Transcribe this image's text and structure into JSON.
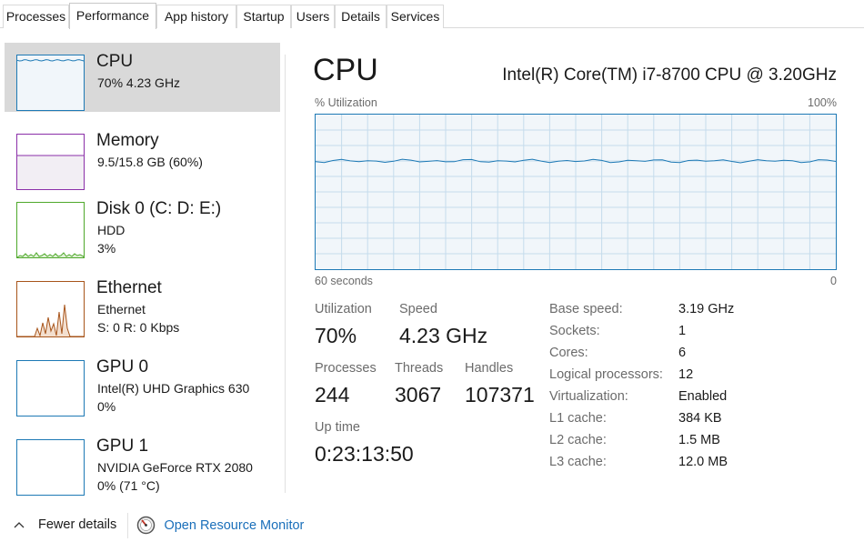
{
  "tabs": [
    {
      "label": "Processes"
    },
    {
      "label": "Performance"
    },
    {
      "label": "App history"
    },
    {
      "label": "Startup"
    },
    {
      "label": "Users"
    },
    {
      "label": "Details"
    },
    {
      "label": "Services"
    }
  ],
  "sidebar": {
    "items": [
      {
        "title": "CPU",
        "lines": [
          "70%  4.23 GHz"
        ],
        "color": "#1d79b5",
        "fill": "#f1f6fa",
        "usage_percent": 70
      },
      {
        "title": "Memory",
        "lines": [
          "9.5/15.8 GB (60%)"
        ],
        "color": "#8b2fa8",
        "fill": "#f2eef4",
        "usage_percent": 60
      },
      {
        "title": "Disk 0 (C: D: E:)",
        "lines": [
          "HDD",
          "3%"
        ],
        "color": "#4ea82a",
        "fill": "#ffffff",
        "usage_percent": 3
      },
      {
        "title": "Ethernet",
        "lines": [
          "Ethernet",
          "S: 0  R: 0 Kbps"
        ],
        "color": "#a7541a",
        "fill": "#ffffff"
      },
      {
        "title": "GPU 0",
        "lines": [
          "Intel(R) UHD Graphics 630",
          "0%"
        ],
        "color": "#1d79b5",
        "fill": "#ffffff",
        "usage_percent": 0
      },
      {
        "title": "GPU 1",
        "lines": [
          "NVIDIA GeForce RTX 2080",
          "0%  (71 °C)"
        ],
        "color": "#1d79b5",
        "fill": "#ffffff",
        "usage_percent": 0
      }
    ]
  },
  "main": {
    "title": "CPU",
    "model": "Intel(R) Core(TM) i7-8700 CPU @ 3.20GHz",
    "graph": {
      "y_label": "% Utilization",
      "y_max_label": "100%",
      "x_left_label": "60 seconds",
      "x_right_label": "0",
      "line_color": "#1d79b5",
      "fill_color": "#f1f6fa",
      "grid_color": "#c5dcec"
    },
    "stats": {
      "utilization_label": "Utilization",
      "utilization_value": "70%",
      "speed_label": "Speed",
      "speed_value": "4.23 GHz",
      "processes_label": "Processes",
      "processes_value": "244",
      "threads_label": "Threads",
      "threads_value": "3067",
      "handles_label": "Handles",
      "handles_value": "107371",
      "uptime_label": "Up time",
      "uptime_value": "0:23:13:50"
    },
    "details": [
      {
        "key": "Base speed:",
        "value": "3.19 GHz"
      },
      {
        "key": "Sockets:",
        "value": "1"
      },
      {
        "key": "Cores:",
        "value": "6"
      },
      {
        "key": "Logical processors:",
        "value": "12"
      },
      {
        "key": "Virtualization:",
        "value": "Enabled"
      },
      {
        "key": "L1 cache:",
        "value": "384 KB"
      },
      {
        "key": "L2 cache:",
        "value": "1.5 MB"
      },
      {
        "key": "L3 cache:",
        "value": "12.0 MB"
      }
    ]
  },
  "footer": {
    "fewer_details_label": "Fewer details",
    "fewer_details_icon": "chevron-up-icon",
    "monitor_label": "Open Resource Monitor",
    "monitor_icon": "resource-monitor-icon"
  }
}
